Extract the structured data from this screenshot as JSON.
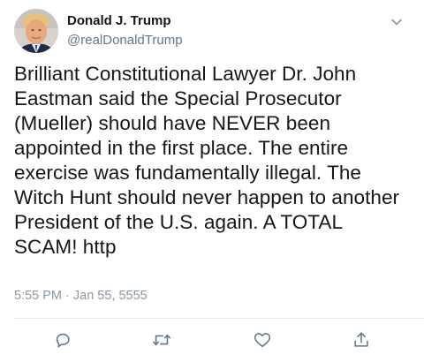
{
  "author": {
    "display_name": "Donald J. Trump",
    "handle": "@realDonaldTrump"
  },
  "tweet": {
    "text": "Brilliant Constitutional Lawyer Dr. John Eastman said the Special Prosecutor (Mueller) should have NEVER been appointed in the first place. The entire exercise was fundamentally illegal. The Witch Hunt should never happen to another President of the U.S. again. A TOTAL SCAM! http",
    "timestamp": "5:55 PM · Jan 55, 5555"
  },
  "icons": {
    "menu": "chevron-down-icon",
    "reply": "reply-icon",
    "retweet": "retweet-icon",
    "like": "heart-icon",
    "share": "share-icon"
  },
  "colors": {
    "text": "#14171a",
    "secondary": "#657786",
    "icon": "#657786",
    "divider": "#e6ecf0"
  }
}
